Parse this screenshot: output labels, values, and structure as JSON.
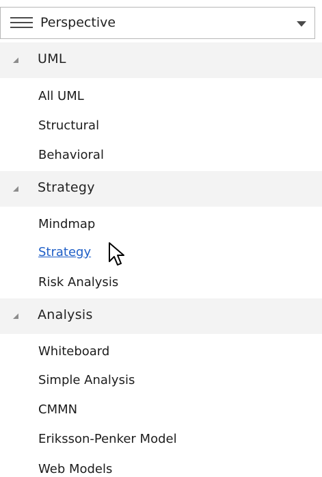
{
  "toolbar": {
    "title": "Perspective",
    "menu_icon": "hamburger-menu-icon",
    "dropdown_icon": "dropdown-arrow-icon"
  },
  "groups": [
    {
      "label": "UML",
      "toggle_icon": "collapse-triangle-icon",
      "items": [
        "All UML",
        "Structural",
        "Behavioral"
      ]
    },
    {
      "label": "Strategy",
      "toggle_icon": "collapse-triangle-icon",
      "items": [
        "Mindmap",
        "Strategy",
        "Risk Analysis"
      ]
    },
    {
      "label": "Analysis",
      "toggle_icon": "collapse-triangle-icon",
      "items": [
        "Whiteboard",
        "Simple Analysis",
        "CMMN",
        "Eriksson-Penker Model",
        "Web Models"
      ]
    }
  ],
  "hovered_item": "Strategy",
  "colors": {
    "link": "#1f5fc7",
    "header_bg": "#f3f3f3",
    "border": "#b7b7b7"
  },
  "cursor_icon": "mouse-pointer-icon"
}
